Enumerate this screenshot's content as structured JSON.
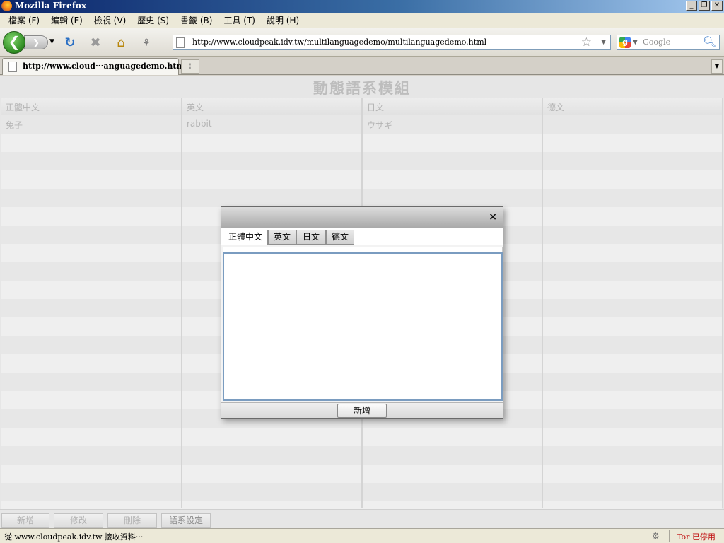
{
  "window": {
    "title": "Mozilla Firefox",
    "min": "_",
    "restore": "❐",
    "close": "✕"
  },
  "menu": [
    "檔案 (F)",
    "編輯 (E)",
    "檢視 (V)",
    "歷史 (S)",
    "書籤 (B)",
    "工具 (T)",
    "說明 (H)"
  ],
  "nav": {
    "back_icon": "back-arrow-icon",
    "forward_icon": "forward-arrow-icon",
    "url": "http://www.cloudpeak.idv.tw/multilanguagedemo/multilanguagedemo.html",
    "search_placeholder": "Google"
  },
  "tabs": {
    "active_label": "http://www.cloud···anguagedemo.html",
    "new_tab": "⊹"
  },
  "page": {
    "title": "動態語系模組",
    "columns": [
      "正體中文",
      "英文",
      "日文",
      "德文"
    ],
    "rows": [
      [
        "兔子",
        "rabbit",
        "ウサギ",
        ""
      ]
    ],
    "buttons": {
      "add": "新增",
      "edit": "修改",
      "delete": "刪除",
      "lang_settings": "語系設定"
    }
  },
  "dialog": {
    "close": "×",
    "tabs": [
      "正體中文",
      "英文",
      "日文",
      "德文"
    ],
    "text_value": "",
    "submit": "新增"
  },
  "status": {
    "message": "從 www.cloudpeak.idv.tw 接收資料···",
    "tor": "Tor 已停用"
  },
  "colors": {
    "titlebar": "#0a246a",
    "back_button": "#2e8b22",
    "tor_status": "#c01010",
    "dialog_border": "#7a9cc0"
  }
}
